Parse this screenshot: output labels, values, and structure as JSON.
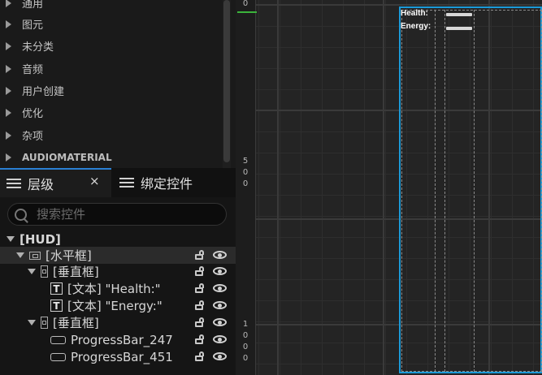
{
  "palette": {
    "categories": [
      {
        "label": "通用"
      },
      {
        "label": "图元"
      },
      {
        "label": "未分类"
      },
      {
        "label": "音频"
      },
      {
        "label": "用户创建"
      },
      {
        "label": "优化"
      },
      {
        "label": "杂项"
      },
      {
        "label": "AUDIOMATERIAL"
      }
    ]
  },
  "tabs": {
    "hierarchy": "层级",
    "close": "×",
    "bind_widgets": "绑定控件"
  },
  "search": {
    "placeholder": "搜索控件",
    "value": ""
  },
  "tree": {
    "root": "[HUD]",
    "items": [
      {
        "label": "[水平框]"
      },
      {
        "label": "[垂直框]"
      },
      {
        "label": "[文本] \"Health:\""
      },
      {
        "label": "[文本] \"Energy:\""
      },
      {
        "label": "[垂直框]"
      },
      {
        "label": "ProgressBar_247"
      },
      {
        "label": "ProgressBar_451"
      }
    ]
  },
  "ruler": {
    "marks": [
      "0",
      "5",
      "0",
      "0",
      "1",
      "0",
      "0",
      "0"
    ]
  },
  "widget": {
    "health_label": "Health:",
    "energy_label": "Energy:"
  },
  "colors": {
    "selection": "#1b9ad8",
    "accent": "#2a7fd4",
    "origin": "#3bb33b"
  }
}
